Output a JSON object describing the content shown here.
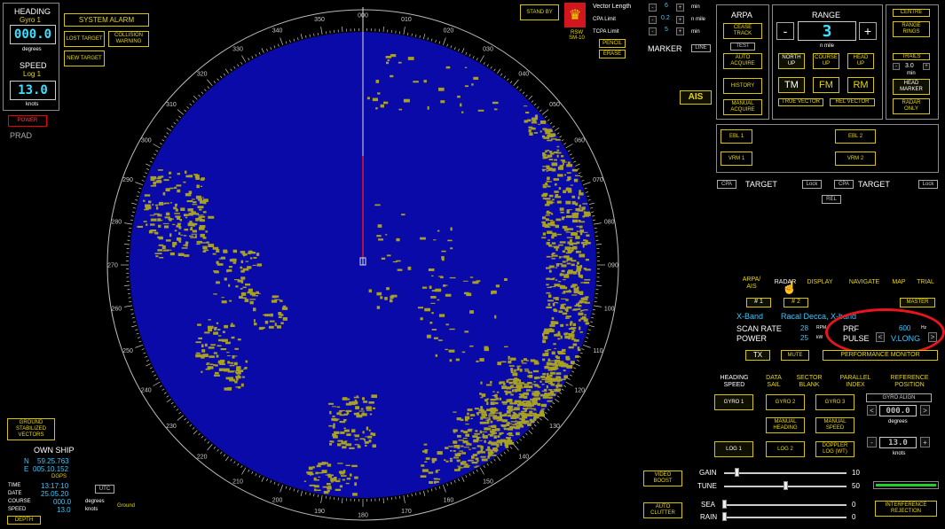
{
  "heading": {
    "title": "HEADING",
    "source": "Gyro 1",
    "value": "000.0",
    "unit": "degrees"
  },
  "speed": {
    "title": "SPEED",
    "source": "Log 1",
    "value": "13.0",
    "unit": "knots"
  },
  "left_buttons": {
    "system_alarm": "SYSTEM ALARM",
    "lost_target": "LOST TARGET",
    "collision_warning": "COLLISION WARNING",
    "new_target": "NEW TARGET",
    "power": "POWER",
    "prad": "PRAD",
    "ground_stabilized": "GROUND STABILIZED VECTORS"
  },
  "own_ship": {
    "title": "OWN SHIP",
    "n_label": "N",
    "lat": "59.25.763",
    "e_label": "E",
    "lon": "005.10.152",
    "dgps": "DGPS",
    "time_label": "TIME",
    "time": "13:17:10",
    "date_label": "DATE",
    "date": "25.05.20",
    "course_label": "COURSE",
    "course": "000.0",
    "course_unit": "degrees",
    "speed_label": "SPEED",
    "speed": "13.0",
    "speed_unit": "knots",
    "utc": "UTC",
    "ground": "Ground",
    "depth": "DEPTH"
  },
  "radar": {
    "bearings": [
      "000",
      "010",
      "020",
      "030",
      "040",
      "050",
      "060",
      "070",
      "080",
      "090",
      "100",
      "110",
      "120",
      "130",
      "140",
      "150",
      "160",
      "170",
      "180",
      "190",
      "200",
      "210",
      "220",
      "230",
      "240",
      "250",
      "260",
      "270",
      "280",
      "290",
      "300",
      "310",
      "320",
      "330",
      "340",
      "350"
    ]
  },
  "top_center": {
    "stand_by": "STAND BY",
    "logo_label": "RSW SM-10",
    "vector_length": "Vector Length",
    "vector_value": "6",
    "vector_unit": "min",
    "cpa_limit": "CPA Limit",
    "cpa_value": "0.2",
    "cpa_unit": "n mile",
    "tcpa_limit": "TCPA Limit",
    "tcpa_value": "5",
    "tcpa_unit": "min",
    "pencil": "PENCIL",
    "erase": "ERASE",
    "marker": "MARKER",
    "line": "LINE",
    "ais": "AIS",
    "minus": "-",
    "plus": "+"
  },
  "arpa": {
    "title": "ARPA",
    "cease_track": "CEASE TRACK",
    "test": "TEST",
    "auto_acquire": "AUTO ACQUIRE",
    "history": "HISTORY",
    "manual_acquire": "MANUAL ACQUIRE"
  },
  "range": {
    "title": "RANGE",
    "minus": "-",
    "value": "3",
    "plus": "+",
    "unit": "n mile",
    "north_up": "NORTH UP",
    "course_up": "COURSE UP",
    "head_up": "HEAD UP",
    "tm": "TM",
    "fm": "FM",
    "rm": "RM",
    "true_vector": "TRUE VECTOR",
    "rel_vector": "REL VECTOR"
  },
  "right_top": {
    "centre": "CENTRE",
    "range_rings": "RANGE RINGS",
    "trails": "TRAILS",
    "trails_value": "3.0",
    "trails_unit": "min",
    "head_marker": "HEAD MARKER",
    "radar_only": "RADAR ONLY"
  },
  "ebl_vrm": {
    "ebl1": "EBL 1",
    "ebl2": "EBL 2",
    "vrm1": "VRM 1",
    "vrm2": "VRM 2"
  },
  "target": {
    "cpa": "CPA",
    "label": "TARGET",
    "lock": "Lock",
    "rel": "REL"
  },
  "tabs": {
    "arpa_ais": "ARPA/ AIS",
    "radar": "RADAR",
    "display": "DISPLAY",
    "navigate": "NAVIGATE",
    "map": "MAP",
    "trial": "TRIAL"
  },
  "radar_panel": {
    "radar1": "# 1",
    "radar2": "# 2",
    "master": "MASTER",
    "band": "X-Band",
    "model": "Racal Decca, X-band",
    "scan_rate_label": "SCAN RATE",
    "scan_rate": "28",
    "scan_rate_unit": "RPM",
    "power_label": "POWER",
    "power": "25",
    "power_unit": "kW",
    "prf_label": "PRF",
    "prf": "600",
    "prf_unit": "Hz",
    "pulse_label": "PULSE",
    "pulse": "V.LONG",
    "prev": "<",
    "next": ">",
    "tx": "TX",
    "mute": "MUTE",
    "performance_monitor": "PERFORMANCE MONITOR"
  },
  "sensors": {
    "tab_heading_speed": "HEADING SPEED",
    "tab_data_sail": "DATA SAIL",
    "tab_sector_blank": "SECTOR BLANK",
    "tab_parallel_index": "PARALLEL INDEX",
    "tab_reference_position": "REFERENCE POSITION",
    "gyro1": "GYRO 1",
    "gyro2": "GYRO 2",
    "gyro3": "GYRO 3",
    "gyro_align": "GYRO ALIGN",
    "manual_heading": "MANUAL HEADING",
    "manual_speed": "MANUAL SPEED",
    "gyro_value": "000.0",
    "gyro_unit": "degrees",
    "log1": "LOG 1",
    "log2": "LOG 2",
    "doppler_log": "DOPPLER LOG (WT)",
    "speed_value": "13.0",
    "speed_unit": "knots",
    "prev": "<",
    "next": ">",
    "minus": "-",
    "plus": "+"
  },
  "controls": {
    "video_boost": "VIDEO BOOST",
    "auto_clutter": "AUTO CLUTTER",
    "interference_rejection": "INTERFERENCE REJECTION",
    "gain_label": "GAIN",
    "gain": 10,
    "gain_value": "10",
    "tune_label": "TUNE",
    "tune": 50,
    "tune_value": "50",
    "sea_label": "SEA",
    "sea": 0,
    "sea_value": "0",
    "rain_label": "RAIN",
    "rain": 0,
    "rain_value": "0"
  },
  "colors": {
    "accent": "#e8d700",
    "radar_bg": "#0a0aa8",
    "echo": "#a8a020",
    "highlight_ring": "#e8141e",
    "digit": "#3ee0ff",
    "tune_bar": "#1fd02a"
  }
}
